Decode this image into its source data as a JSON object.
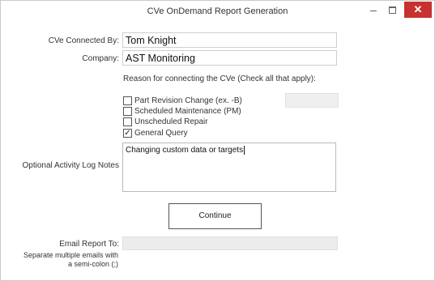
{
  "window": {
    "title": "CVe OnDemand Report Generation",
    "minimize_glyph": "–",
    "close_glyph": "✕",
    "close_color": "#c7312f"
  },
  "form": {
    "connected_by_label": "CVe Connected By:",
    "connected_by_value": "Tom Knight",
    "company_label": "Company:",
    "company_value": "AST Monitoring",
    "reason_prompt": "Reason for connecting the CVe (Check all that apply):",
    "reasons": [
      {
        "label": "Part Revision Change (ex. -B)",
        "checked": false
      },
      {
        "label": "Scheduled Maintenance (PM)",
        "checked": false
      },
      {
        "label": "Unscheduled Repair",
        "checked": false
      },
      {
        "label": "General Query",
        "checked": true
      }
    ],
    "notes_label": "Optional Activity Log Notes",
    "notes_value": "Changing custom data or targets",
    "continue_label": "Continue",
    "email_label": "Email Report To:",
    "email_value": "",
    "email_hint_line1": "Separate multiple emails with",
    "email_hint_line2": "a semi-colon (;)"
  }
}
